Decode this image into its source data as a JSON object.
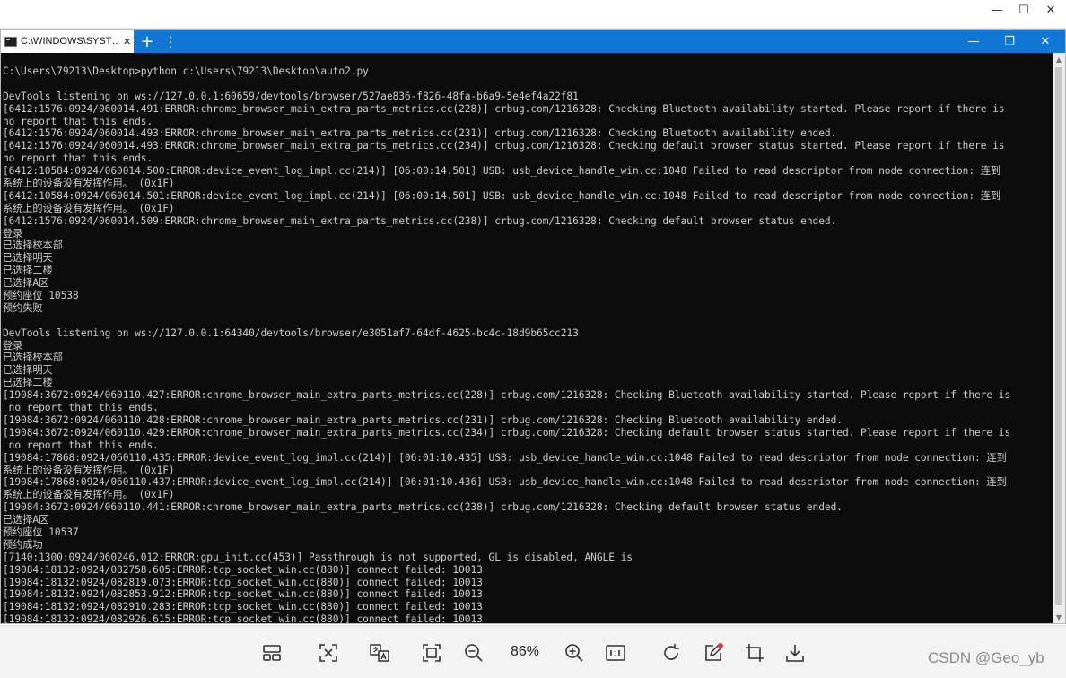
{
  "viewer": {
    "window_controls": {
      "minimize": "—",
      "maximize": "☐",
      "close": "✕"
    },
    "zoom": "86%",
    "watermark": "CSDN @Geo_yb",
    "toolbar_icons": [
      "layout-icon",
      "fit-icon",
      "translate-icon",
      "fullscreen-icon",
      "zoom-out-icon",
      "zoom-in-icon",
      "actual-size-icon",
      "rotate-icon",
      "edit-icon",
      "crop-icon",
      "download-icon"
    ]
  },
  "terminal": {
    "tab_title": "C:\\WINDOWS\\SYST…",
    "tab_close": "✕",
    "new_tab": "+",
    "menu": "⋮",
    "controls": {
      "minimize": "—",
      "maximize": "❐",
      "close": "✕"
    },
    "tab_color": "#1177d7",
    "lines": [
      "C:\\Users\\79213\\Desktop>python c:\\Users\\79213\\Desktop\\auto2.py",
      "",
      "DevTools listening on ws://127.0.0.1:60659/devtools/browser/527ae836-f826-48fa-b6a9-5e4ef4a22f81",
      "[6412:1576:0924/060014.491:ERROR:chrome_browser_main_extra_parts_metrics.cc(228)] crbug.com/1216328: Checking Bluetooth availability started. Please report if there is",
      "no report that this ends.",
      "[6412:1576:0924/060014.493:ERROR:chrome_browser_main_extra_parts_metrics.cc(231)] crbug.com/1216328: Checking Bluetooth availability ended.",
      "[6412:1576:0924/060014.493:ERROR:chrome_browser_main_extra_parts_metrics.cc(234)] crbug.com/1216328: Checking default browser status started. Please report if there is",
      "no report that this ends.",
      "[6412:10584:0924/060014.500:ERROR:device_event_log_impl.cc(214)] [06:00:14.501] USB: usb_device_handle_win.cc:1048 Failed to read descriptor from node connection: 连到",
      "系统上的设备没有发挥作用。 (0x1F)",
      "[6412:10584:0924/060014.501:ERROR:device_event_log_impl.cc(214)] [06:00:14.501] USB: usb_device_handle_win.cc:1048 Failed to read descriptor from node connection: 连到",
      "系统上的设备没有发挥作用。 (0x1F)",
      "[6412:1576:0924/060014.509:ERROR:chrome_browser_main_extra_parts_metrics.cc(238)] crbug.com/1216328: Checking default browser status ended.",
      "登录",
      "已选择校本部",
      "已选择明天",
      "已选择二楼",
      "已选择A区",
      "预约座位 10538",
      "预约失败",
      "",
      "DevTools listening on ws://127.0.0.1:64340/devtools/browser/e3051af7-64df-4625-bc4c-18d9b65cc213",
      "登录",
      "已选择校本部",
      "已选择明天",
      "已选择二楼",
      "[19084:3672:0924/060110.427:ERROR:chrome_browser_main_extra_parts_metrics.cc(228)] crbug.com/1216328: Checking Bluetooth availability started. Please report if there is",
      " no report that this ends.",
      "[19084:3672:0924/060110.428:ERROR:chrome_browser_main_extra_parts_metrics.cc(231)] crbug.com/1216328: Checking Bluetooth availability ended.",
      "[19084:3672:0924/060110.429:ERROR:chrome_browser_main_extra_parts_metrics.cc(234)] crbug.com/1216328: Checking default browser status started. Please report if there is",
      " no report that this ends.",
      "[19084:17868:0924/060110.435:ERROR:device_event_log_impl.cc(214)] [06:01:10.435] USB: usb_device_handle_win.cc:1048 Failed to read descriptor from node connection: 连到",
      "系统上的设备没有发挥作用。 (0x1F)",
      "[19084:17868:0924/060110.437:ERROR:device_event_log_impl.cc(214)] [06:01:10.436] USB: usb_device_handle_win.cc:1048 Failed to read descriptor from node connection: 连到",
      "系统上的设备没有发挥作用。 (0x1F)",
      "[19084:3672:0924/060110.441:ERROR:chrome_browser_main_extra_parts_metrics.cc(238)] crbug.com/1216328: Checking default browser status ended.",
      "已选择A区",
      "预约座位 10537",
      "预约成功",
      "[7140:1300:0924/060246.012:ERROR:gpu_init.cc(453)] Passthrough is not supported, GL is disabled, ANGLE is",
      "[19084:18132:0924/082758.605:ERROR:tcp_socket_win.cc(880)] connect failed: 10013",
      "[19084:18132:0924/082819.073:ERROR:tcp_socket_win.cc(880)] connect failed: 10013",
      "[19084:18132:0924/082853.912:ERROR:tcp_socket_win.cc(880)] connect failed: 10013",
      "[19084:18132:0924/082910.283:ERROR:tcp_socket_win.cc(880)] connect failed: 10013",
      "[19084:18132:0924/082926.615:ERROR:tcp_socket_win.cc(880)] connect failed: 10013"
    ]
  }
}
